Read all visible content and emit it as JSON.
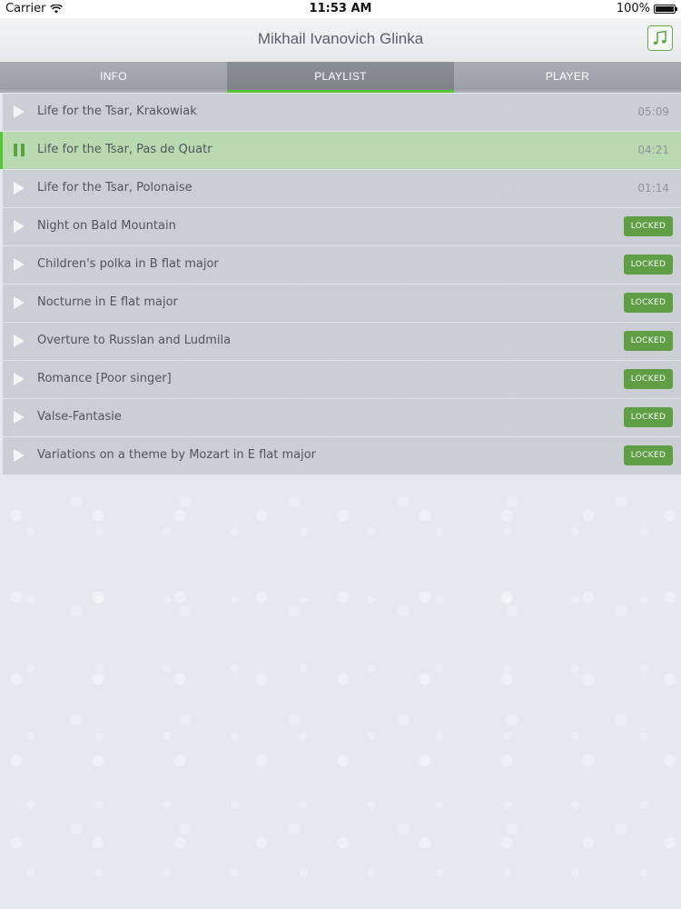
{
  "status_bar": {
    "carrier": "Carrier",
    "time": "11:53 AM",
    "battery": "100%"
  },
  "header": {
    "title": "Mikhail Ivanovich Glinka",
    "music_icon": "music-note-icon"
  },
  "tabs": [
    {
      "label": "INFO",
      "active": false
    },
    {
      "label": "PLAYLIST",
      "active": true
    },
    {
      "label": "PLAYER",
      "active": false
    }
  ],
  "colors": {
    "accent": "#58c43a",
    "locked_badge": "#5f9e45"
  },
  "playlist": [
    {
      "title": "Life for the Tsar, Krakowiak",
      "duration": "05:09",
      "state": "play"
    },
    {
      "title": "Life for the Tsar, Pas de Quatr",
      "duration": "04:21",
      "state": "pause"
    },
    {
      "title": "Life for the Tsar, Polonaise",
      "duration": "01:14",
      "state": "play"
    },
    {
      "title": "Night on Bald Mountain",
      "badge": "LOCKED",
      "state": "play"
    },
    {
      "title": "Children's polka in B flat major",
      "badge": "LOCKED",
      "state": "play"
    },
    {
      "title": "Nocturne in E flat major",
      "badge": "LOCKED",
      "state": "play"
    },
    {
      "title": "Overture to Russlan and Ludmila",
      "badge": "LOCKED",
      "state": "play"
    },
    {
      "title": "Romance [Poor singer]",
      "badge": "LOCKED",
      "state": "play"
    },
    {
      "title": "Valse-Fantasie",
      "badge": "LOCKED",
      "state": "play"
    },
    {
      "title": "Variations on a theme by Mozart in E flat major",
      "badge": "LOCKED",
      "state": "play"
    }
  ]
}
